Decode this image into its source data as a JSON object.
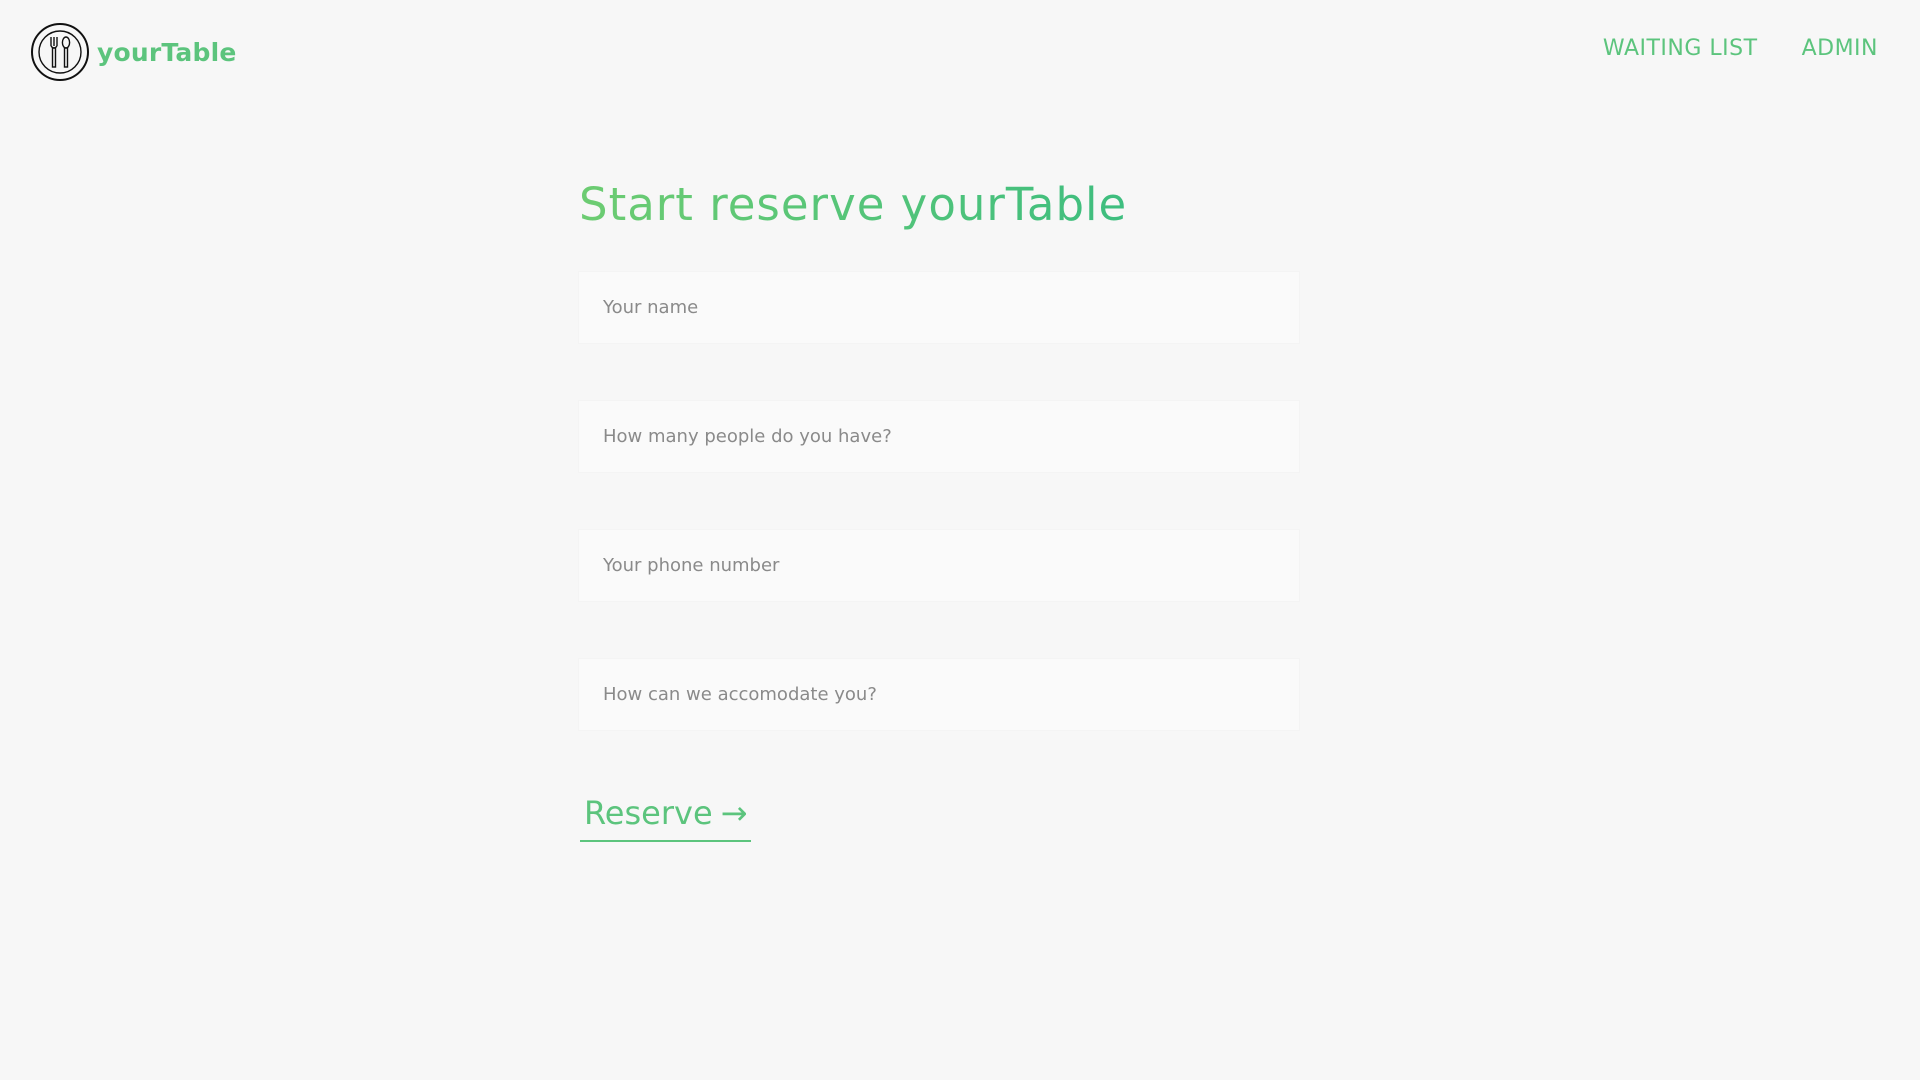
{
  "header": {
    "brand_name": "yourTable",
    "logo_icon": "plate-fork-spoon-icon",
    "nav": [
      {
        "label": "WAITING LIST"
      },
      {
        "label": "ADMIN"
      }
    ]
  },
  "main": {
    "title": "Start reserve yourTable",
    "fields": [
      {
        "placeholder": "Your name",
        "value": ""
      },
      {
        "placeholder": "How many people do you have?",
        "value": ""
      },
      {
        "placeholder": "Your phone number",
        "value": ""
      },
      {
        "placeholder": "How can we accomodate you?",
        "value": ""
      }
    ],
    "submit_label": "Reserve",
    "submit_arrow": "→"
  },
  "colors": {
    "accent": "#5cc47d",
    "title_gradient_start": "#6dcc72",
    "title_gradient_end": "#2fb983",
    "background": "#f7f7f7",
    "field_background": "#fafafa"
  }
}
